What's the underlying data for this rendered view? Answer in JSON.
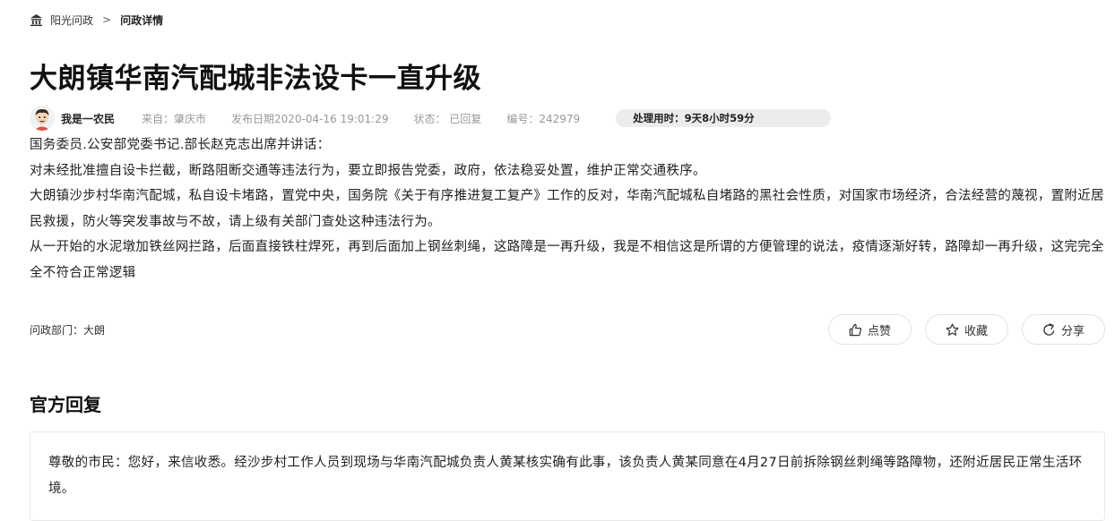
{
  "breadcrumb": {
    "home_label": "阳光问政",
    "separator": ">",
    "current": "问政详情"
  },
  "post": {
    "title": "大朗镇华南汽配城非法设卡一直升级",
    "author": "我是一农民",
    "from_label": "来自：肇庆市",
    "date_label": "发布日期2020-04-16 19:01:29",
    "status_label": "状态： 已回复",
    "number_label": "编号：242979",
    "elapsed_label": "处理用时：",
    "elapsed_value": "9天8小时59分",
    "paragraphs": [
      "国务委员.公安部党委书记.部长赵克志出席并讲话：",
      "对未经批准擅自设卡拦截，断路阻断交通等违法行为，要立即报告党委，政府，依法稳妥处置，维护正常交通秩序。",
      "大朗镇沙步村华南汽配城，私自设卡堵路，置党中央，国务院《关于有序推进复工复产》工作的反对，华南汽配城私自堵路的黑社会性质，对国家市场经济，合法经营的蔑视，置附近居民救援，防火等突发事故与不故，请上级有关部门查处这种违法行为。",
      "从一开始的水泥墩加铁丝网拦路，后面直接铁柱焊死，再到后面加上钢丝刺绳，这路障是一再升级，我是不相信这是所谓的方便管理的说法，疫情逐渐好转，路障却一再升级，这完完全全不符合正常逻辑"
    ],
    "dept_label": "问政部门：大朗"
  },
  "actions": {
    "like_label": "点赞",
    "favorite_label": "收藏",
    "share_label": "分享"
  },
  "reply": {
    "heading": "官方回复",
    "text": "尊敬的市民：您好，来信收悉。经沙步村工作人员到现场与华南汽配城负责人黄某核实确有此事，该负责人黄某同意在4月27日前拆除钢丝刺绳等路障物，还附近居民正常生活环境。"
  },
  "icons": {
    "home": "home-icon",
    "like": "thumbs-up-icon",
    "favorite": "star-icon",
    "share": "share-icon",
    "avatar": "cartoon-avatar"
  },
  "colors": {
    "text": "#222222",
    "meta": "#999999",
    "badge_bg": "#ececec",
    "border": "#e2e2e2"
  }
}
